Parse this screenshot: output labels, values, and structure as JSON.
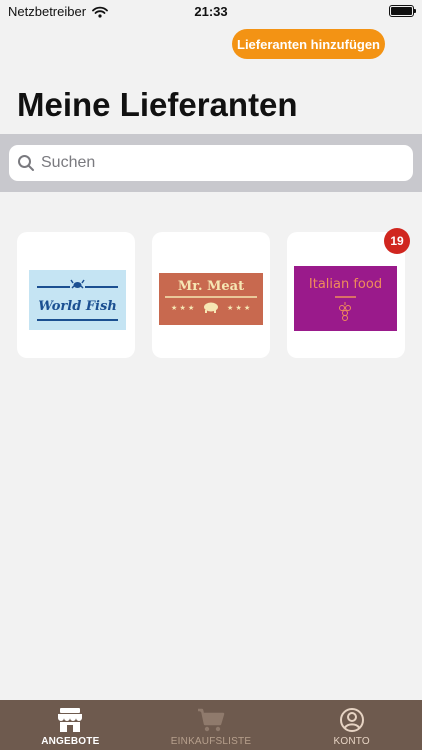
{
  "status_bar": {
    "carrier": "Netzbetreiber",
    "time": "21:33"
  },
  "header": {
    "add_button_label": "Lieferanten hinzufügen",
    "title": "Meine Lieferanten"
  },
  "search": {
    "placeholder": "Suchen",
    "value": ""
  },
  "suppliers": [
    {
      "logo_text": "World Fish",
      "colors": {
        "background": "#c5e4f3",
        "foreground": "#1b4f91"
      }
    },
    {
      "logo_text": "Mr. Meat",
      "colors": {
        "background": "#c8694f",
        "foreground": "#f6e7b4"
      }
    },
    {
      "logo_text": "Italian food",
      "badge": "19",
      "colors": {
        "background": "#9a1a8b",
        "foreground": "#f08c5a"
      }
    }
  ],
  "tabs": [
    {
      "label": "ANGEBOTE",
      "icon": "storefront-icon",
      "active": true
    },
    {
      "label": "EINKAUFSLISTE",
      "icon": "cart-icon",
      "active": false
    },
    {
      "label": "KONTO",
      "icon": "account-icon",
      "active": false
    }
  ],
  "colors": {
    "accent": "#f39314",
    "tab_bar": "#6e5a4e",
    "badge": "#d0261f",
    "search_band": "#c8c8cd"
  }
}
